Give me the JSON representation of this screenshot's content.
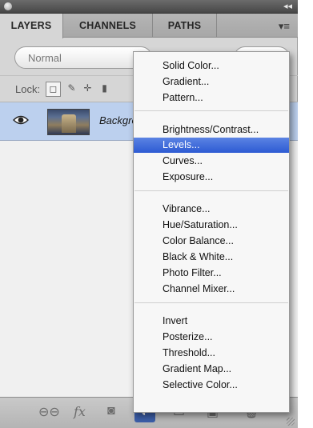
{
  "panel": {
    "collapse_icon": "double-chevron-icon",
    "tabs": [
      "LAYERS",
      "CHANNELS",
      "PATHS"
    ],
    "menu_icon": "panel-menu-icon"
  },
  "options": {
    "blend_mode": "Normal",
    "lock_label": "Lock:",
    "lock_icons": [
      "lock-transparency-icon",
      "lock-image-icon",
      "lock-position-icon",
      "lock-all-icon"
    ]
  },
  "layers": [
    {
      "name": "Background",
      "visible": true,
      "icon": "eye-icon"
    }
  ],
  "footer": {
    "buttons": [
      "link-layers-icon",
      "fx-icon",
      "layer-mask-icon",
      "adjustment-layer-icon",
      "new-group-icon",
      "new-layer-icon",
      "trash-icon"
    ],
    "fx_label": "fx"
  },
  "adjustment_menu": {
    "highlighted": "Levels...",
    "groups": [
      [
        "Solid Color...",
        "Gradient...",
        "Pattern..."
      ],
      [
        "Brightness/Contrast...",
        "Levels...",
        "Curves...",
        "Exposure..."
      ],
      [
        "Vibrance...",
        "Hue/Saturation...",
        "Color Balance...",
        "Black & White...",
        "Photo Filter...",
        "Channel Mixer..."
      ],
      [
        "Invert",
        "Posterize...",
        "Threshold...",
        "Gradient Map...",
        "Selective Color..."
      ]
    ]
  },
  "colors": {
    "highlight": "#2d5bd3",
    "layer_selected": "#bcd0ee"
  }
}
